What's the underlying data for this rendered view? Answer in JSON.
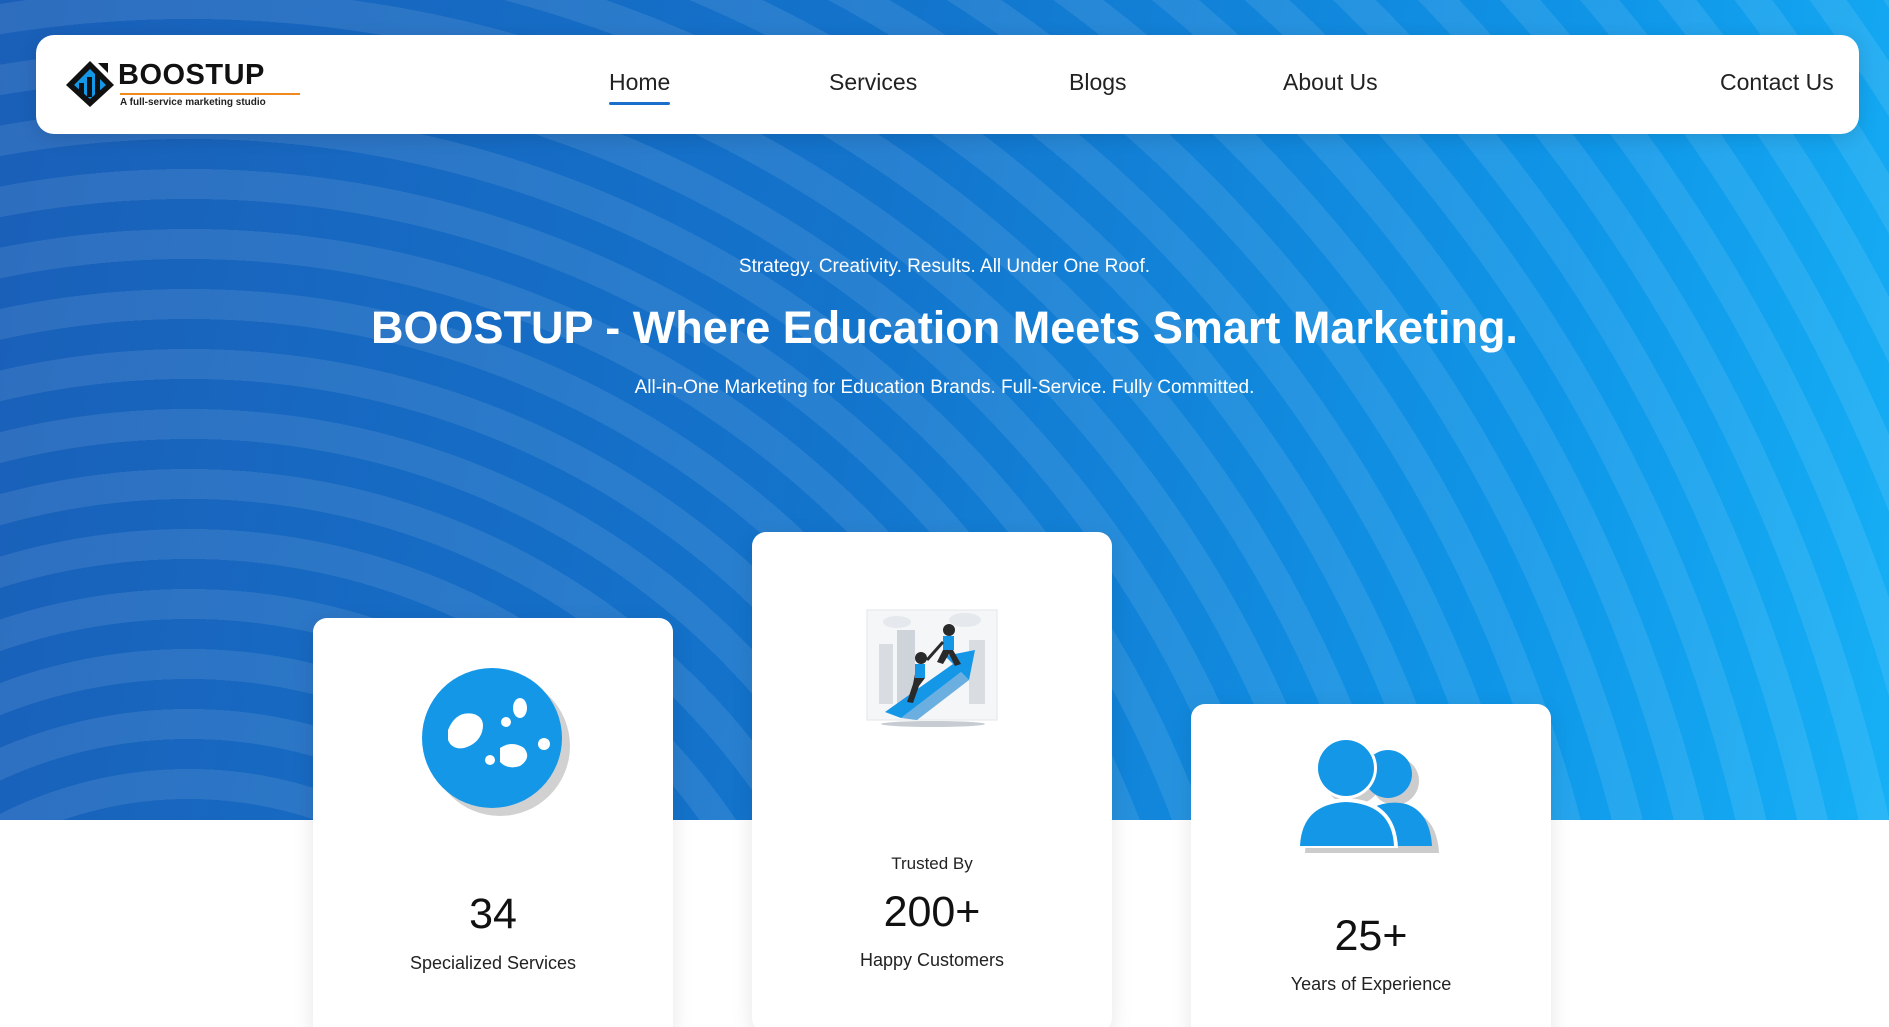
{
  "brand": {
    "name": "BOOSTUP",
    "tagline": "A full-service marketing studio"
  },
  "nav": {
    "items": [
      {
        "label": "Home",
        "active": true
      },
      {
        "label": "Services"
      },
      {
        "label": "Blogs"
      },
      {
        "label": "About Us"
      },
      {
        "label": "Contact Us"
      }
    ]
  },
  "hero": {
    "kicker": "Strategy. Creativity. Results. All Under One Roof.",
    "title": "BOOSTUP - Where Education Meets Smart Marketing.",
    "subtitle": "All-in-One Marketing for Education Brands. Full-Service. Fully Committed."
  },
  "stats": [
    {
      "icon": "globe-icon",
      "number": "34",
      "label": "Specialized Services"
    },
    {
      "icon": "growth-illustration-icon",
      "prefix": "Trusted By",
      "number": "200+",
      "label": "Happy Customers"
    },
    {
      "icon": "users-icon",
      "number": "25+",
      "label": "Years of Experience"
    }
  ],
  "colors": {
    "accent": "#1a6fcc",
    "icon_blue": "#1597e8",
    "hero_start": "#1a5fb8",
    "hero_end": "#16b0f6",
    "logo_orange": "#f08a1c"
  }
}
